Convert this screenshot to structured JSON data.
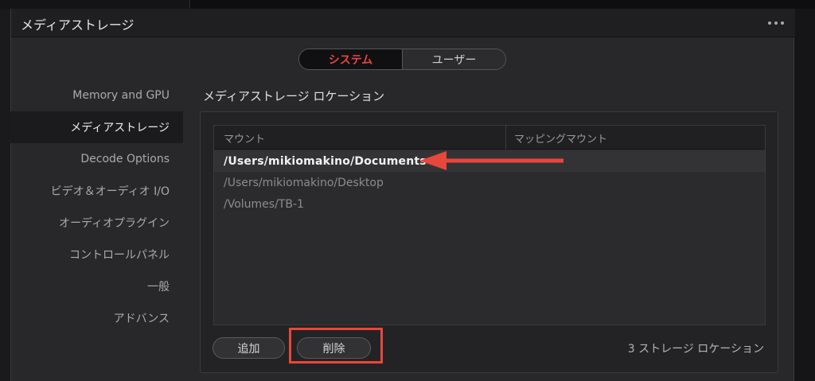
{
  "window": {
    "title": "メディアストレージ"
  },
  "tabs": {
    "system": "システム",
    "user": "ユーザー",
    "active": "system"
  },
  "sidebar": {
    "items": [
      {
        "label": "Memory and GPU"
      },
      {
        "label": "メディアストレージ",
        "selected": true
      },
      {
        "label": "Decode Options"
      },
      {
        "label": "ビデオ＆オーディオ I/O"
      },
      {
        "label": "オーディオプラグイン"
      },
      {
        "label": "コントロールパネル"
      },
      {
        "label": "一般"
      },
      {
        "label": "アドバンス"
      }
    ]
  },
  "main": {
    "section_title": "メディアストレージ ロケーション",
    "table": {
      "columns": [
        "マウント",
        "マッピングマウント"
      ],
      "rows": [
        {
          "mount": "/Users/mikiomakino/Documents",
          "mapped": "",
          "selected": true
        },
        {
          "mount": "/Users/mikiomakino/Desktop",
          "mapped": ""
        },
        {
          "mount": "/Volumes/TB-1",
          "mapped": ""
        }
      ]
    },
    "buttons": {
      "add": "追加",
      "delete": "削除"
    },
    "count_label": "3 ストレージ ロケーション"
  },
  "colors": {
    "accent": "#e8473c",
    "annotation": "#e8473c"
  }
}
